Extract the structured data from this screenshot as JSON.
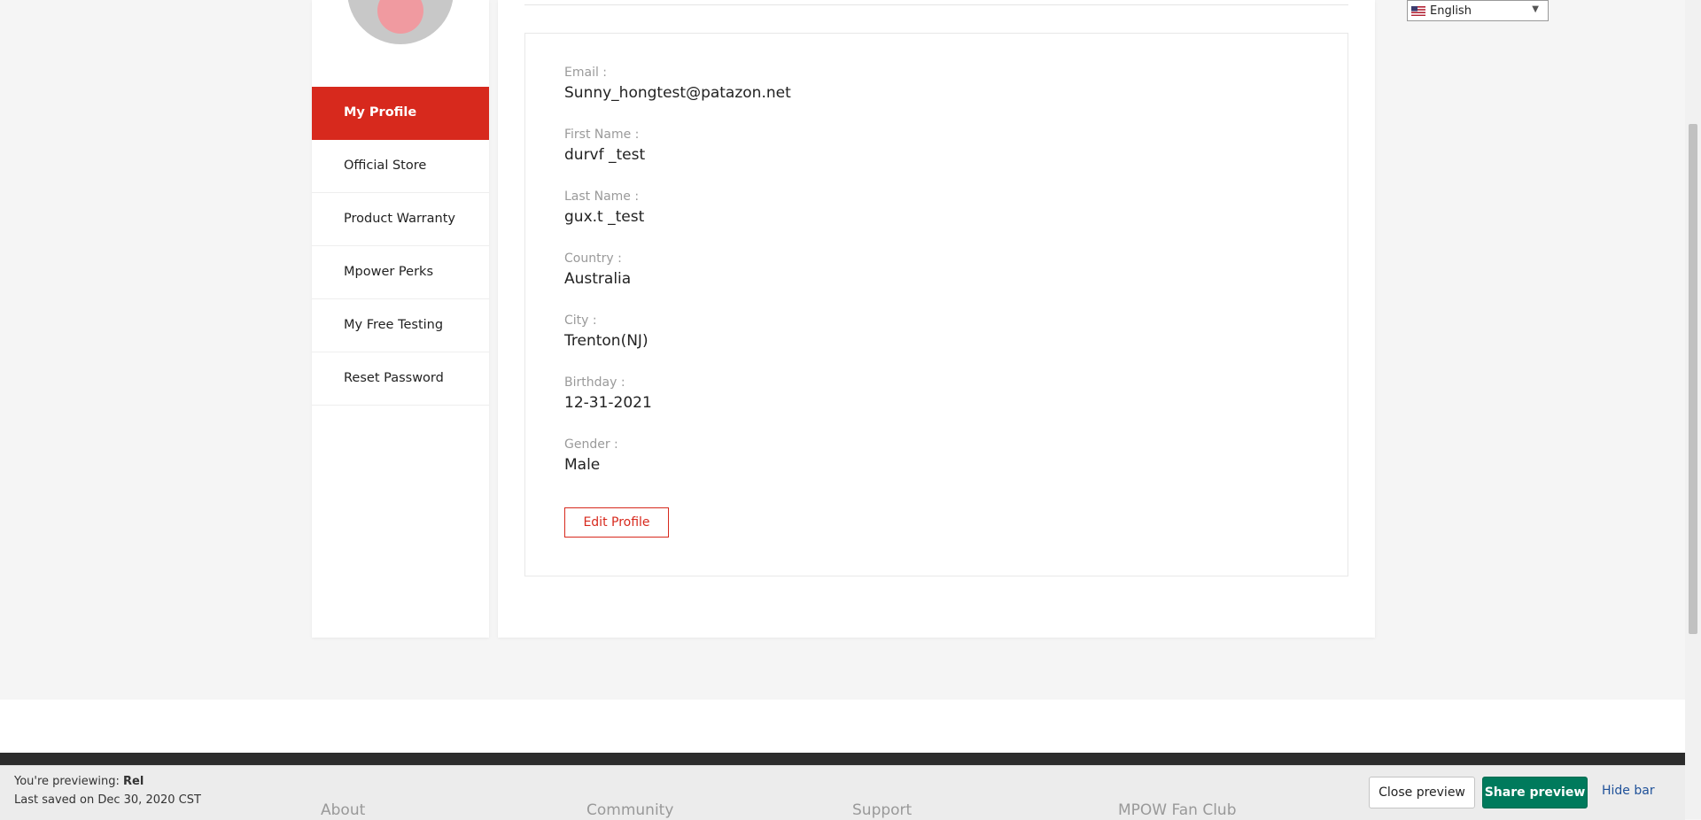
{
  "sidebar": {
    "items": [
      {
        "label": "My Profile"
      },
      {
        "label": "Official Store"
      },
      {
        "label": "Product Warranty"
      },
      {
        "label": "Mpower Perks"
      },
      {
        "label": "My Free Testing"
      },
      {
        "label": "Reset Password"
      }
    ],
    "active_index": 0
  },
  "profile": {
    "fields": [
      {
        "label": "Email :",
        "value": "Sunny_hongtest@patazon.net"
      },
      {
        "label": "First Name :",
        "value": "durvf _test"
      },
      {
        "label": "Last Name :",
        "value": "gux.t _test"
      },
      {
        "label": "Country :",
        "value": "Australia"
      },
      {
        "label": "City :",
        "value": "Trenton(NJ)"
      },
      {
        "label": "Birthday :",
        "value": "12-31-2021"
      },
      {
        "label": "Gender :",
        "value": "Male"
      }
    ],
    "edit_button": "Edit Profile"
  },
  "language": {
    "selected": "English",
    "flag_icon": "us-flag-icon"
  },
  "footer": {
    "columns": [
      "About",
      "Community",
      "Support",
      "MPOW Fan Club"
    ]
  },
  "preview_bar": {
    "previewing_prefix": "You're previewing: ",
    "previewing_name": "Rel",
    "last_saved": "Last saved on Dec 30, 2020 CST",
    "close_label": "Close preview",
    "share_label": "Share preview",
    "hide_label": "Hide bar"
  },
  "colors": {
    "accent": "#d7291d",
    "share_green": "#007a5c",
    "link_blue": "#1f5199"
  }
}
